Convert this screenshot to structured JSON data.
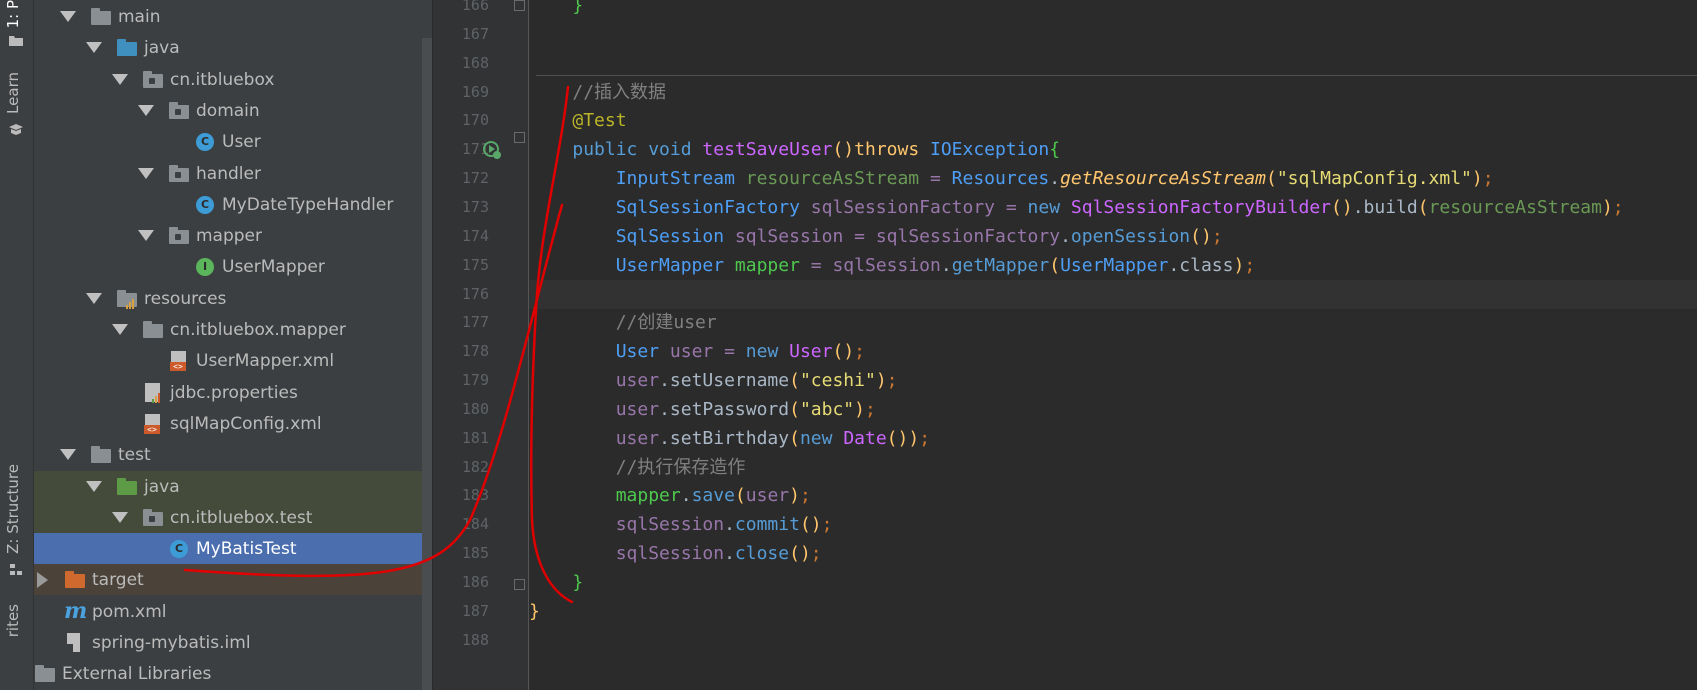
{
  "tool_strip": {
    "tab_project": "1: P",
    "tab_learn": "Learn",
    "tab_structure": "Z: Structure",
    "tab_favorites": "rites"
  },
  "project_tree": [
    {
      "label": "main",
      "depth": 1,
      "arrow": "down",
      "icon": "folder",
      "color": "#8a8f94"
    },
    {
      "label": "java",
      "depth": 2,
      "arrow": "down",
      "icon": "folder",
      "color": "#3f8fbf"
    },
    {
      "label": "cn.itbluebox",
      "depth": 3,
      "arrow": "down",
      "icon": "package",
      "color": "#8a8f94"
    },
    {
      "label": "domain",
      "depth": 4,
      "arrow": "down",
      "icon": "package",
      "color": "#8a8f94"
    },
    {
      "label": "User",
      "depth": 5,
      "arrow": "none",
      "icon": "class",
      "color": "#3d9bd6"
    },
    {
      "label": "handler",
      "depth": 4,
      "arrow": "down",
      "icon": "package",
      "color": "#8a8f94"
    },
    {
      "label": "MyDateTypeHandler",
      "depth": 5,
      "arrow": "none",
      "icon": "class",
      "color": "#3d9bd6"
    },
    {
      "label": "mapper",
      "depth": 4,
      "arrow": "down",
      "icon": "package",
      "color": "#8a8f94"
    },
    {
      "label": "UserMapper",
      "depth": 5,
      "arrow": "none",
      "icon": "interface",
      "color": "#5bb55b"
    },
    {
      "label": "resources",
      "depth": 2,
      "arrow": "down",
      "icon": "resources",
      "color": "#8a8f94"
    },
    {
      "label": "cn.itbluebox.mapper",
      "depth": 3,
      "arrow": "down",
      "icon": "folder",
      "color": "#8a8f94"
    },
    {
      "label": "UserMapper.xml",
      "depth": 4,
      "arrow": "none",
      "icon": "xml",
      "color": "#cc5a2a"
    },
    {
      "label": "jdbc.properties",
      "depth": 3,
      "arrow": "none",
      "icon": "properties",
      "color": "#bfbfbf"
    },
    {
      "label": "sqlMapConfig.xml",
      "depth": 3,
      "arrow": "none",
      "icon": "xml",
      "color": "#cc5a2a"
    },
    {
      "label": "test",
      "depth": 1,
      "arrow": "down",
      "icon": "folder",
      "color": "#8a8f94"
    },
    {
      "label": "java",
      "depth": 2,
      "arrow": "down",
      "icon": "folder",
      "color": "#5d9b47",
      "style": "testsrc"
    },
    {
      "label": "cn.itbluebox.test",
      "depth": 3,
      "arrow": "down",
      "icon": "package",
      "color": "#8a8f94",
      "style": "testsrc"
    },
    {
      "label": "MyBatisTest",
      "depth": 4,
      "arrow": "none",
      "icon": "testclass",
      "color": "#3d9bd6",
      "style": "sel"
    },
    {
      "label": "target",
      "depth": 0,
      "arrow": "right",
      "icon": "folder",
      "color": "#d0692e",
      "style": "excl"
    },
    {
      "label": "pom.xml",
      "depth": 0,
      "arrow": "none",
      "icon": "maven",
      "color": "#4aa3df"
    },
    {
      "label": "spring-mybatis.iml",
      "depth": 0,
      "arrow": "none",
      "icon": "iml",
      "color": "#bfbfbf"
    },
    {
      "label": "External Libraries",
      "depth": -1,
      "arrow": "none",
      "icon": "libs",
      "color": "#8a8f94"
    }
  ],
  "gutter": {
    "line_numbers": [
      "166",
      "167",
      "168",
      "169",
      "170",
      "171",
      "172",
      "173",
      "174",
      "175",
      "176",
      "177",
      "178",
      "179",
      "180",
      "181",
      "182",
      "183",
      "184",
      "185",
      "186",
      "187",
      "188"
    ]
  },
  "code": [
    [
      [
        "    ",
        ""
      ],
      [
        "}",
        "grn"
      ]
    ],
    [],
    [],
    [
      [
        "    ",
        ""
      ],
      [
        "//插入数据",
        "cm"
      ]
    ],
    [
      [
        "    ",
        ""
      ],
      [
        "@Test",
        "ann"
      ]
    ],
    [
      [
        "    ",
        ""
      ],
      [
        "public void ",
        "kwb"
      ],
      [
        "testSaveUser",
        "cls2"
      ],
      [
        "()",
        "fn"
      ],
      [
        "throws ",
        "fn"
      ],
      [
        "IOException",
        "ty"
      ],
      [
        "{",
        "grn"
      ]
    ],
    [
      [
        "        ",
        ""
      ],
      [
        "InputStream ",
        "ty"
      ],
      [
        "resourceAsStream ",
        "dim"
      ],
      [
        "= ",
        "vr"
      ],
      [
        "Resources",
        "ty"
      ],
      [
        ".",
        ""
      ],
      [
        "getResourceAsStream",
        "mt it"
      ],
      [
        "(",
        "fn"
      ],
      [
        "\"sqlMapConfig.xml\"",
        "str"
      ],
      [
        ")",
        "fn"
      ],
      [
        ";",
        "pun"
      ]
    ],
    [
      [
        "        ",
        ""
      ],
      [
        "SqlSessionFactory ",
        "ty"
      ],
      [
        "sqlSessionFactory ",
        "vr"
      ],
      [
        "= ",
        "vr"
      ],
      [
        "new ",
        "kwb"
      ],
      [
        "SqlSessionFactoryBuilder",
        "cls2"
      ],
      [
        "()",
        "fn"
      ],
      [
        ".build",
        ""
      ],
      [
        "(",
        "fn"
      ],
      [
        "resourceAsStream",
        "dim"
      ],
      [
        ")",
        "fn"
      ],
      [
        ";",
        "pun"
      ]
    ],
    [
      [
        "        ",
        ""
      ],
      [
        "SqlSession ",
        "ty"
      ],
      [
        "sqlSession ",
        "vr"
      ],
      [
        "= ",
        "vr"
      ],
      [
        "sqlSessionFactory",
        "vr"
      ],
      [
        ".",
        ""
      ],
      [
        "openSession",
        "kwb"
      ],
      [
        "()",
        "fn"
      ],
      [
        ";",
        "pun"
      ]
    ],
    [
      [
        "        ",
        ""
      ],
      [
        "UserMapper ",
        "ty"
      ],
      [
        "mapper ",
        "grn"
      ],
      [
        "= ",
        "vr"
      ],
      [
        "sqlSession",
        "vr"
      ],
      [
        ".",
        ""
      ],
      [
        "getMapper",
        "kwb"
      ],
      [
        "(",
        "fn"
      ],
      [
        "UserMapper",
        "ty"
      ],
      [
        ".class",
        ""
      ],
      [
        ")",
        "fn"
      ],
      [
        ";",
        "pun"
      ]
    ],
    [],
    [
      [
        "        ",
        ""
      ],
      [
        "//创建user",
        "cm"
      ]
    ],
    [
      [
        "        ",
        ""
      ],
      [
        "User ",
        "ty"
      ],
      [
        "user ",
        "vr"
      ],
      [
        "= ",
        "vr"
      ],
      [
        "new ",
        "kwb"
      ],
      [
        "User",
        "cls2"
      ],
      [
        "()",
        "fn"
      ],
      [
        ";",
        "pun"
      ]
    ],
    [
      [
        "        ",
        ""
      ],
      [
        "user",
        "vr"
      ],
      [
        ".setUsername",
        ""
      ],
      [
        "(",
        "fn"
      ],
      [
        "\"ceshi\"",
        "str"
      ],
      [
        ")",
        "fn"
      ],
      [
        ";",
        "pun"
      ]
    ],
    [
      [
        "        ",
        ""
      ],
      [
        "user",
        "vr"
      ],
      [
        ".setPassword",
        ""
      ],
      [
        "(",
        "fn"
      ],
      [
        "\"abc\"",
        "str"
      ],
      [
        ")",
        "fn"
      ],
      [
        ";",
        "pun"
      ]
    ],
    [
      [
        "        ",
        ""
      ],
      [
        "user",
        "vr"
      ],
      [
        ".setBirthday",
        ""
      ],
      [
        "(",
        "fn"
      ],
      [
        "new ",
        "kwb"
      ],
      [
        "Date",
        "cls2"
      ],
      [
        "()",
        "fn"
      ],
      [
        ")",
        "fn"
      ],
      [
        ";",
        "pun"
      ]
    ],
    [
      [
        "        ",
        ""
      ],
      [
        "//执行保存造作",
        "cm"
      ]
    ],
    [
      [
        "        ",
        ""
      ],
      [
        "mapper",
        "grn"
      ],
      [
        ".",
        ""
      ],
      [
        "save",
        "kwb"
      ],
      [
        "(",
        "fn"
      ],
      [
        "user",
        "vr"
      ],
      [
        ")",
        "fn"
      ],
      [
        ";",
        "pun"
      ]
    ],
    [
      [
        "        ",
        ""
      ],
      [
        "sqlSession",
        "vr"
      ],
      [
        ".",
        ""
      ],
      [
        "commit",
        "kwb"
      ],
      [
        "()",
        "fn"
      ],
      [
        ";",
        "pun"
      ]
    ],
    [
      [
        "        ",
        ""
      ],
      [
        "sqlSession",
        "vr"
      ],
      [
        ".",
        ""
      ],
      [
        "close",
        "kwb"
      ],
      [
        "()",
        "fn"
      ],
      [
        ";",
        "pun"
      ]
    ],
    [
      [
        "    ",
        ""
      ],
      [
        "}",
        "grn"
      ]
    ],
    [
      [
        "}",
        "fn"
      ]
    ],
    []
  ],
  "current_line_index": 10
}
